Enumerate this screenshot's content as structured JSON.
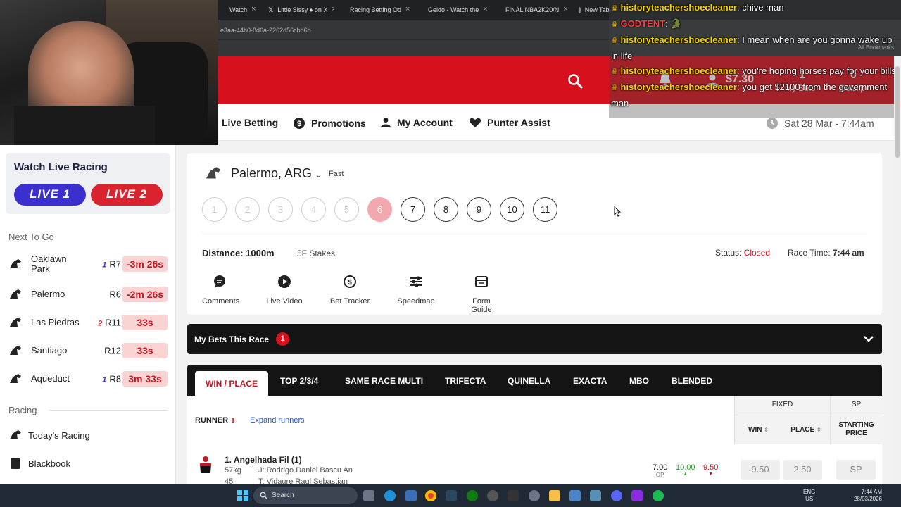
{
  "browser": {
    "tabs": [
      {
        "label": "Watch",
        "color": "#9146ff"
      },
      {
        "label": "Little Sissy ♦ on X",
        "color": "#000000"
      },
      {
        "label": "Racing Betting Od",
        "color": "#d6101c"
      },
      {
        "label": "Geido - Watch the",
        "color": "#3fb54a"
      },
      {
        "label": "FINAL NBA2K20/N",
        "color": "#ff0000"
      },
      {
        "label": "New Tab",
        "color": "#888888"
      }
    ],
    "new_tab": "+",
    "address": "e3aa-44b0-8d6a-2262d56cbb6b",
    "all_bookmarks": "All Bookmarks"
  },
  "chat": [
    {
      "user": "historyteachershoecleaner",
      "msg": ": chive man",
      "user_color": "yellow"
    },
    {
      "user": "GODTENT",
      "msg": ": 🐊",
      "user_color": "red"
    },
    {
      "user": "historyteachershoecleaner",
      "msg": ": I mean when are you gonna wake up in life",
      "user_color": "yellow"
    },
    {
      "user": "historyteachershoecleaner",
      "msg": ": you're hoping horses pay for your bills",
      "user_color": "yellow"
    },
    {
      "user": "historyteachershoecleaner",
      "msg": ": you get $2100 from the government man",
      "user_color": "yellow"
    }
  ],
  "header": {
    "balance": "$7.30",
    "mybets_count": "1",
    "mybets_label": "My Bets",
    "betslip_count": "0",
    "betslip_label": "Betslip",
    "nav": [
      "Live Betting",
      "Promotions",
      "My Account",
      "Punter Assist"
    ],
    "datetime": "Sat 28 Mar - 7:44am"
  },
  "sidebar": {
    "watch_title": "Watch Live Racing",
    "live1": "LIVE 1",
    "live2": "LIVE 2",
    "next_to_go_title": "Next To Go",
    "next_to_go": [
      {
        "venue": "Oaklawn Park",
        "race": "R7",
        "badge": "1",
        "badge_color": "#3b2fcf",
        "countdown": "-3m 26s"
      },
      {
        "venue": "Palermo",
        "race": "R6",
        "badge": "",
        "badge_color": "",
        "countdown": "-2m 26s"
      },
      {
        "venue": "Las Piedras",
        "race": "R11",
        "badge": "2",
        "badge_color": "#d9232f",
        "countdown": "33s"
      },
      {
        "venue": "Santiago",
        "race": "R12",
        "badge": "",
        "badge_color": "",
        "countdown": "33s"
      },
      {
        "venue": "Aqueduct",
        "race": "R8",
        "badge": "1",
        "badge_color": "#3b2fcf",
        "countdown": "3m 33s"
      }
    ],
    "racing_title": "Racing",
    "racing_links": [
      "Today's Racing",
      "Blackbook"
    ]
  },
  "race": {
    "venue": "Palermo, ARG",
    "condition": "Fast",
    "races": [
      "1",
      "2",
      "3",
      "4",
      "5",
      "6",
      "7",
      "8",
      "9",
      "10",
      "11"
    ],
    "active_race": "6",
    "distance": "Distance: 1000m",
    "stakes": "5F Stakes",
    "status_label": "Status:",
    "status_value": "Closed",
    "race_time_label": "Race Time:",
    "race_time_value": "7:44 am",
    "tools": [
      "Comments",
      "Live Video",
      "Bet Tracker",
      "Speedmap",
      "Form Guide"
    ]
  },
  "my_bets": {
    "title": "My Bets This Race",
    "count": "1"
  },
  "bet_types": [
    "WIN / PLACE",
    "TOP 2/3/4",
    "SAME RACE MULTI",
    "TRIFECTA",
    "QUINELLA",
    "EXACTA",
    "MBO",
    "BLENDED"
  ],
  "table": {
    "runner_header": "RUNNER",
    "expand": "Expand runners",
    "fixed": "FIXED",
    "sp": "SP",
    "win": "WIN",
    "place": "PLACE",
    "starting_price": "STARTING PRICE",
    "runner": {
      "name": "1. Angelhada Fil (1)",
      "weight": "57kg",
      "jockey": "J: Rodrigo Daniel Bascu An",
      "number": "45",
      "trainer": "T: Vidaure Raul Sebastian",
      "op": "7.00",
      "op_label": "OP",
      "flux_up": "10.00",
      "flux_down": "9.50",
      "win": "9.50",
      "place": "2.50",
      "sp": "SP"
    }
  },
  "taskbar": {
    "search": "Search",
    "lang1": "ENG",
    "lang2": "US",
    "time": "7:44 AM",
    "date": "28/03/2026"
  }
}
